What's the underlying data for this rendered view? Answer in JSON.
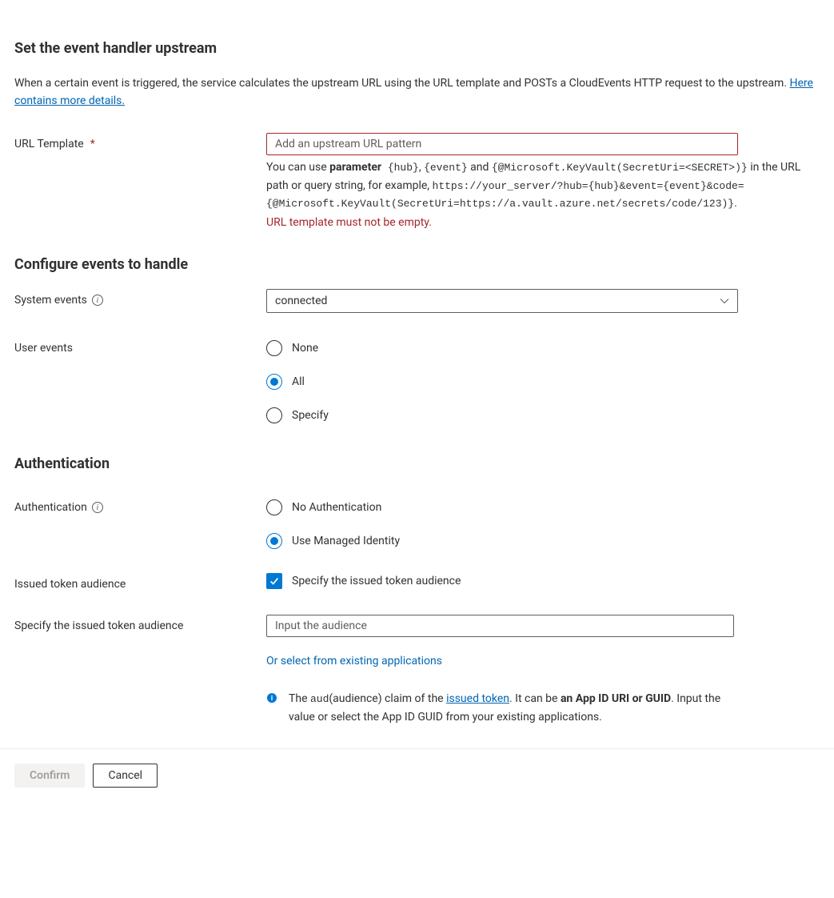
{
  "title": "Set the event handler upstream",
  "intro": {
    "text_a": "When a certain event is triggered, the service calculates the upstream URL using the URL template and POSTs a CloudEvents HTTP request to the upstream. ",
    "link": "Here contains more details."
  },
  "url_template": {
    "label": "URL Template",
    "required": "*",
    "placeholder": "Add an upstream URL pattern",
    "value": "",
    "help": {
      "t1": "You can use ",
      "bold": "parameter",
      "m1": " {hub}",
      "t2": ", ",
      "m2": "{event}",
      "t3": " and ",
      "m3": "{@Microsoft.KeyVault(SecretUri=<SECRET>)}",
      "t4": " in the URL path or query string, for example, ",
      "m4": "https://your_server/?hub={hub}&event={event}&code={@Microsoft.KeyVault(SecretUri=https://a.vault.azure.net/secrets/code/123)}",
      "t5": "."
    },
    "error": "URL template must not be empty."
  },
  "events": {
    "heading": "Configure events to handle",
    "system_label": "System events",
    "system_value": "connected",
    "user_label": "User events",
    "options": {
      "none": "None",
      "all": "All",
      "specify": "Specify"
    },
    "selected": "all"
  },
  "auth": {
    "heading": "Authentication",
    "label": "Authentication",
    "options": {
      "none": "No Authentication",
      "mi": "Use Managed Identity"
    },
    "selected": "mi",
    "issued_label": "Issued token audience",
    "issued_check_label": "Specify the issued token audience",
    "issued_checked": true,
    "specify_label": "Specify the issued token audience",
    "specify_placeholder": "Input the audience",
    "specify_value": "",
    "select_link": "Or select from existing applications",
    "note": {
      "t1": "The ",
      "mono": "aud",
      "t2": "(audience) claim of the ",
      "link": "issued token",
      "t3": ". It can be ",
      "bold": "an App ID URI or GUID",
      "t4": ". Input the value or select the App ID GUID from your existing applications."
    }
  },
  "footer": {
    "confirm": "Confirm",
    "cancel": "Cancel"
  }
}
